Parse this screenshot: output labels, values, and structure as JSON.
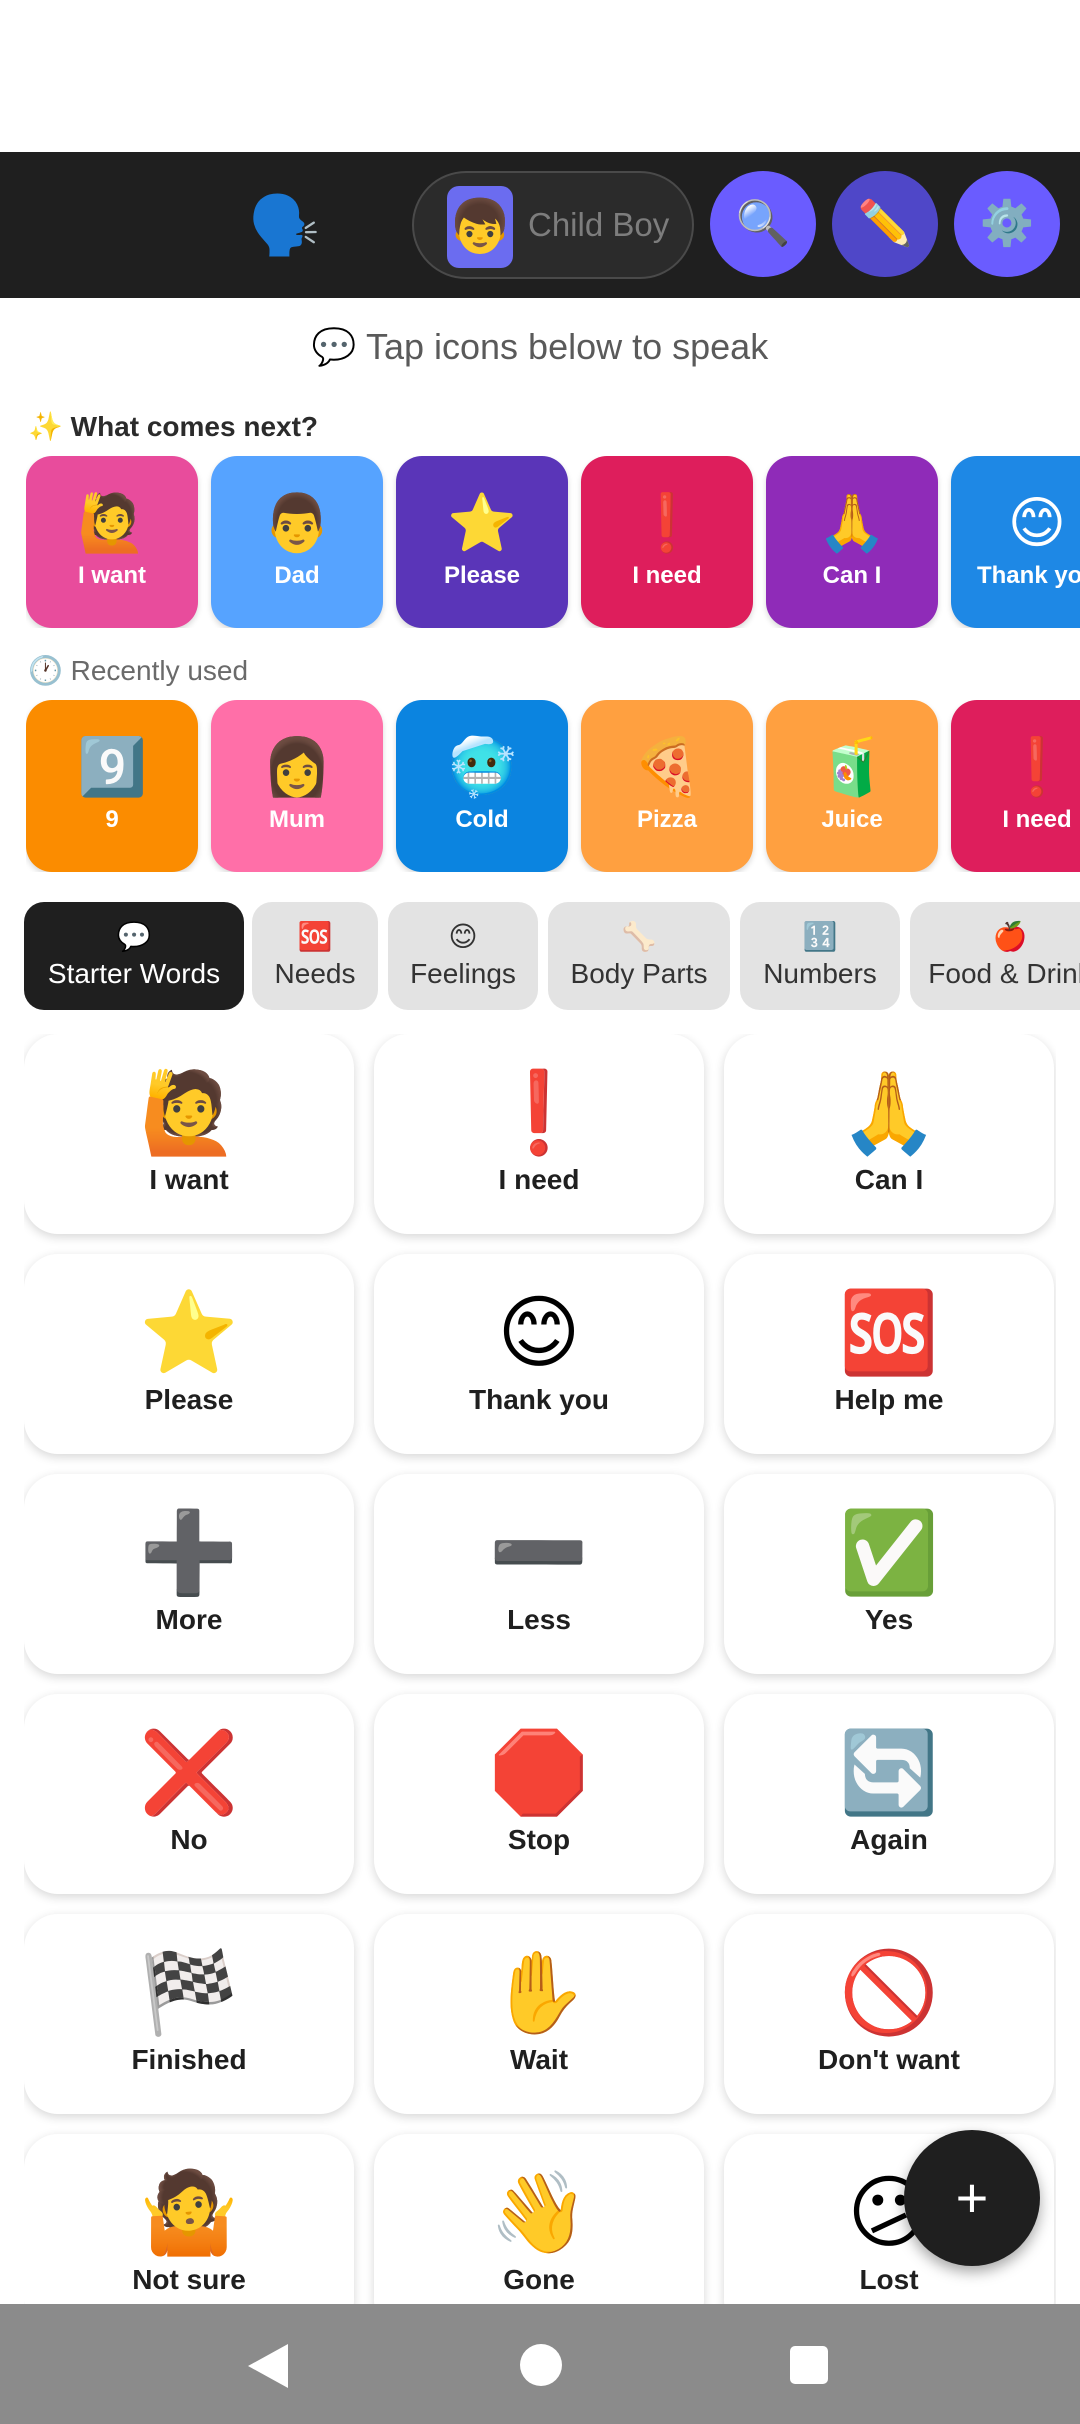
{
  "topbar": {
    "speaker_icon": "🗣️",
    "child_avatar": "👦",
    "child_name": "Child Boy",
    "buttons": [
      {
        "icon": "🔍",
        "name": "search-icon"
      },
      {
        "icon": "✏️",
        "name": "pencil-icon"
      },
      {
        "icon": "⚙️",
        "name": "gear-icon"
      }
    ]
  },
  "hint": "💬 Tap icons below to speak",
  "next": {
    "title": "✨ What comes next?",
    "items": [
      {
        "emoji": "🙋",
        "label": "I want",
        "color": "#e84c9c"
      },
      {
        "emoji": "👨",
        "label": "Dad",
        "color": "#56a3ff"
      },
      {
        "emoji": "⭐",
        "label": "Please",
        "color": "#5a35b8"
      },
      {
        "emoji": "❗",
        "label": "I need",
        "color": "#de1e5c"
      },
      {
        "emoji": "🙏",
        "label": "Can I",
        "color": "#8f2bb8"
      },
      {
        "emoji": "😊",
        "label": "Thank you",
        "color": "#1e88e5"
      }
    ]
  },
  "recent": {
    "title": "🕐 Recently used",
    "items": [
      {
        "emoji": "9️⃣",
        "label": "9",
        "color": "#fb8c00"
      },
      {
        "emoji": "👩",
        "label": "Mum",
        "color": "#ff6fa8"
      },
      {
        "emoji": "🥶",
        "label": "Cold",
        "color": "#0b84e0"
      },
      {
        "emoji": "🍕",
        "label": "Pizza",
        "color": "#ffa040"
      },
      {
        "emoji": "🧃",
        "label": "Juice",
        "color": "#ffa040"
      },
      {
        "emoji": "❗",
        "label": "I need",
        "color": "#de1e5c"
      }
    ]
  },
  "categories": [
    {
      "emoji": "💬",
      "label": "Starter Words",
      "active": true
    },
    {
      "emoji": "🆘",
      "label": "Needs"
    },
    {
      "emoji": "😊",
      "label": "Feelings"
    },
    {
      "emoji": "🦴",
      "label": "Body Parts"
    },
    {
      "emoji": "🔢",
      "label": "Numbers"
    },
    {
      "emoji": "🍎",
      "label": "Food & Drink"
    }
  ],
  "words": [
    {
      "emoji": "🙋",
      "label": "I want"
    },
    {
      "emoji": "❗",
      "label": "I need"
    },
    {
      "emoji": "🙏",
      "label": "Can I"
    },
    {
      "emoji": "⭐",
      "label": "Please"
    },
    {
      "emoji": "😊",
      "label": "Thank you"
    },
    {
      "emoji": "🆘",
      "label": "Help me"
    },
    {
      "emoji": "➕",
      "label": "More"
    },
    {
      "emoji": "➖",
      "label": "Less"
    },
    {
      "emoji": "✅",
      "label": "Yes"
    },
    {
      "emoji": "❌",
      "label": "No"
    },
    {
      "emoji": "🛑",
      "label": "Stop"
    },
    {
      "emoji": "🔄",
      "label": "Again"
    },
    {
      "emoji": "🏁",
      "label": "Finished"
    },
    {
      "emoji": "✋",
      "label": "Wait"
    },
    {
      "emoji": "🚫",
      "label": "Don't want"
    },
    {
      "emoji": "🤷",
      "label": "Not sure"
    },
    {
      "emoji": "👋",
      "label": "Gone"
    },
    {
      "emoji": "😕",
      "label": "Lost"
    }
  ],
  "fab": {
    "icon": "+"
  }
}
